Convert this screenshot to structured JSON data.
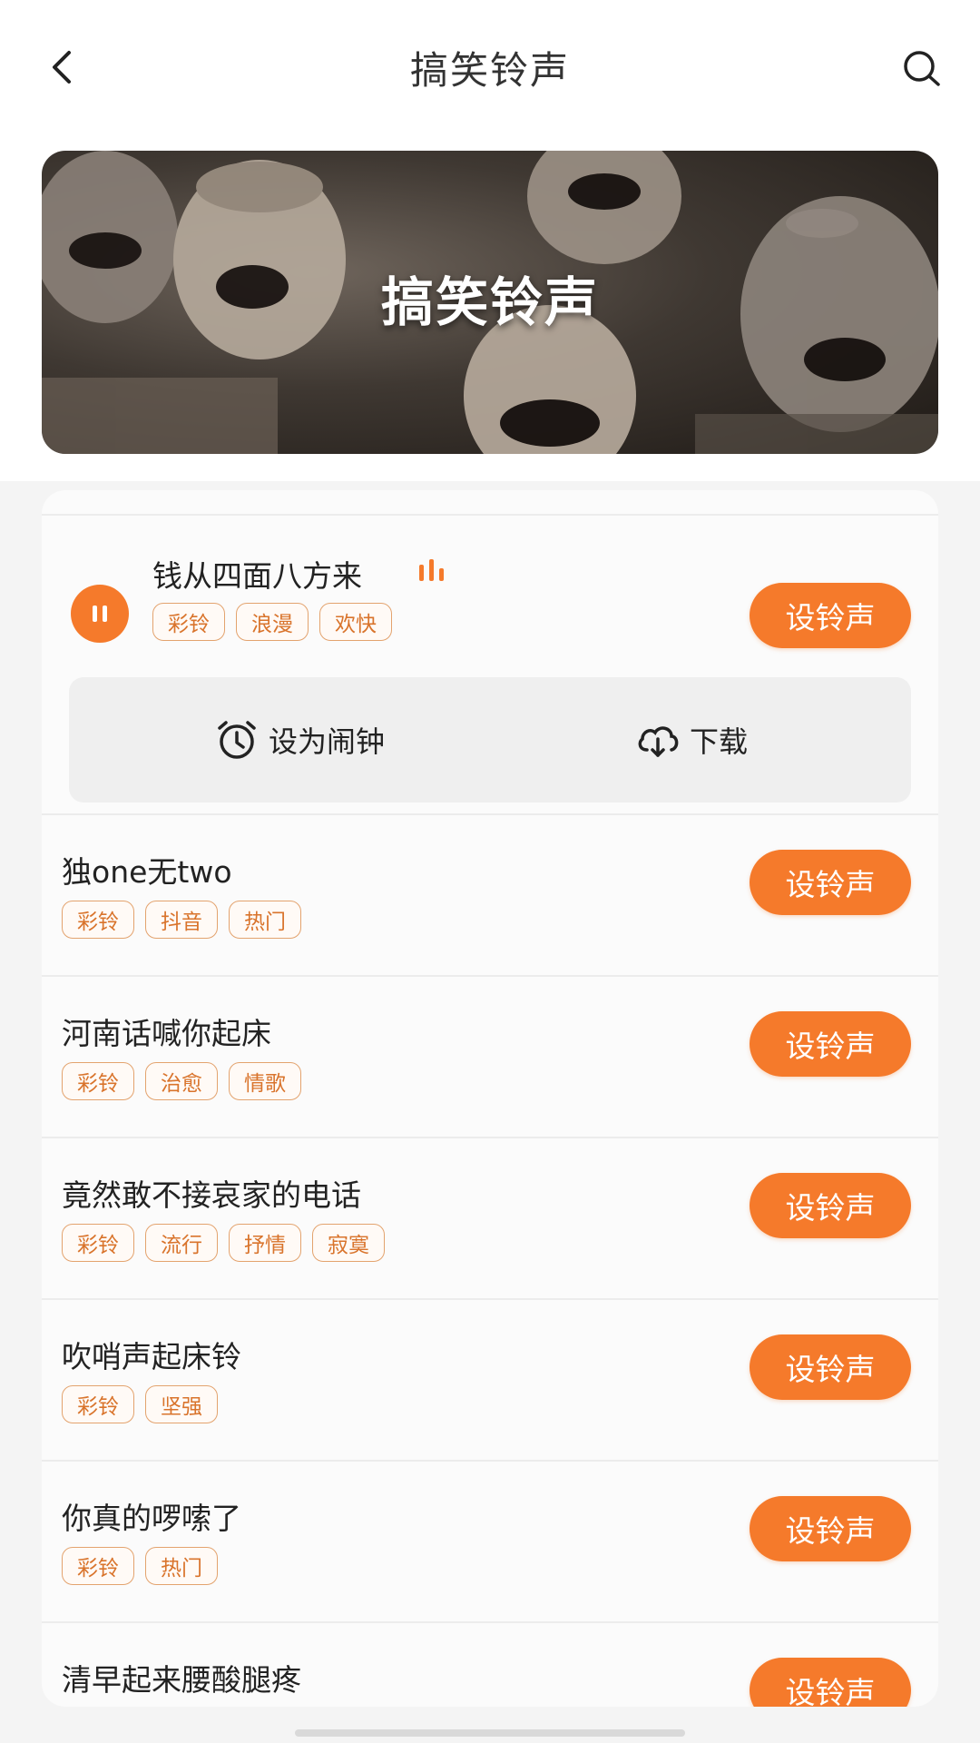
{
  "header": {
    "title": "搞笑铃声"
  },
  "banner": {
    "title": "搞笑铃声"
  },
  "items": [
    {
      "title": "钱从四面八方来",
      "tags": [
        "彩铃",
        "浪漫",
        "欢快"
      ],
      "button": "设铃声",
      "playing": true
    },
    {
      "title": "独one无two",
      "tags": [
        "彩铃",
        "抖音",
        "热门"
      ],
      "button": "设铃声"
    },
    {
      "title": "河南话喊你起床",
      "tags": [
        "彩铃",
        "治愈",
        "情歌"
      ],
      "button": "设铃声"
    },
    {
      "title": "竟然敢不接哀家的电话",
      "tags": [
        "彩铃",
        "流行",
        "抒情",
        "寂寞"
      ],
      "button": "设铃声"
    },
    {
      "title": "吹哨声起床铃",
      "tags": [
        "彩铃",
        "坚强"
      ],
      "button": "设铃声"
    },
    {
      "title": "你真的啰嗦了",
      "tags": [
        "彩铃",
        "热门"
      ],
      "button": "设铃声"
    },
    {
      "title": "清早起来腰酸腿疼",
      "tags": [],
      "button": "设铃声"
    }
  ],
  "actions": {
    "alarm": "设为闹钟",
    "download": "下载"
  },
  "colors": {
    "accent": "#f57a2b",
    "tag_text": "#d9742c",
    "tag_border": "#e3a36e"
  }
}
